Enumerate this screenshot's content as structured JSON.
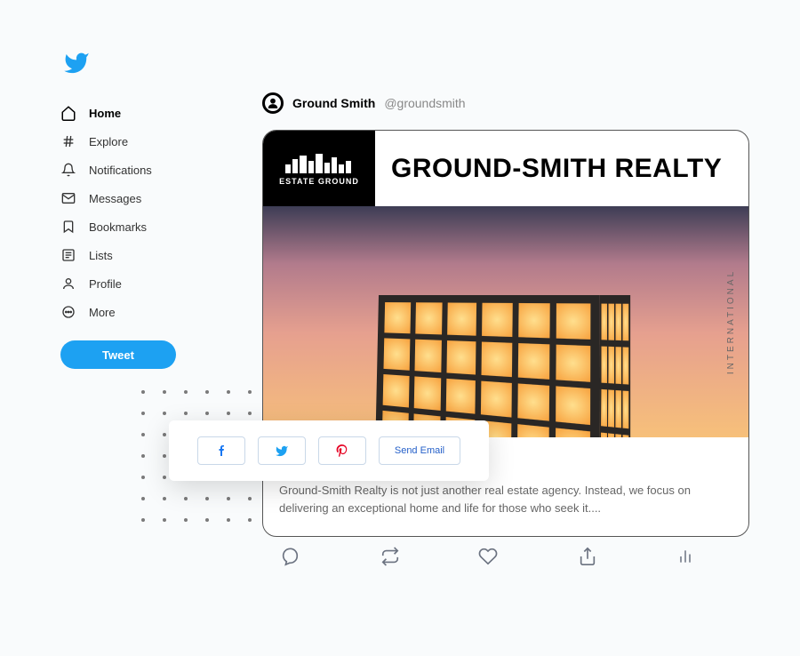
{
  "sidebar": {
    "items": [
      {
        "label": "Home",
        "active": true
      },
      {
        "label": "Explore"
      },
      {
        "label": "Notifications"
      },
      {
        "label": "Messages"
      },
      {
        "label": "Bookmarks"
      },
      {
        "label": "Lists"
      },
      {
        "label": "Profile"
      },
      {
        "label": "More"
      }
    ],
    "tweet_label": "Tweet"
  },
  "tweet": {
    "author_name": "Ground Smith",
    "author_handle": "@groundsmith",
    "card": {
      "brand_sub": "ESTATE GROUND",
      "headline": "GROUND-SMITH REALTY",
      "side_label": "INTERNATIONAL",
      "body": "Ground-Smith Realty is not just another real estate agency. Instead, we focus on delivering an exceptional home and life for those who seek it...."
    }
  },
  "share": {
    "email_label": "Send Email"
  }
}
